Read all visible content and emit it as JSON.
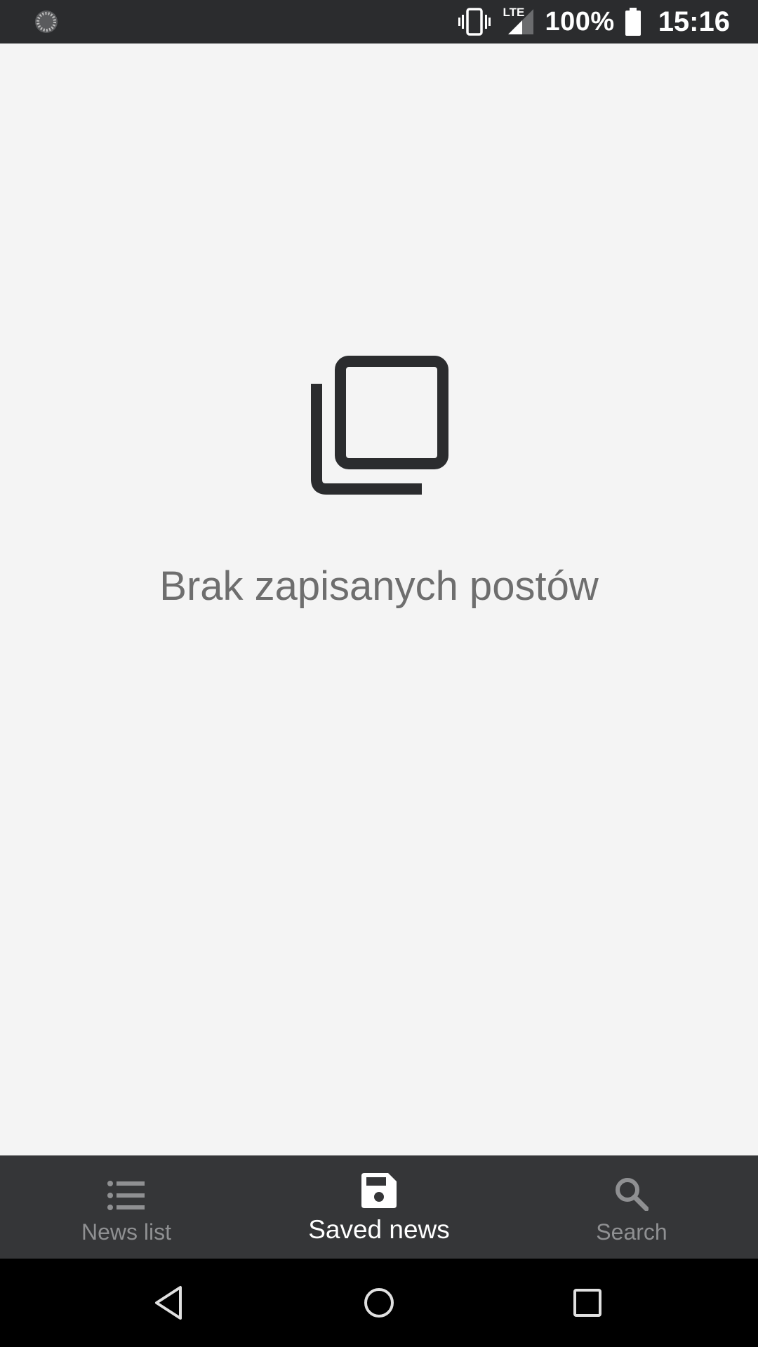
{
  "status_bar": {
    "spinner_icon": "sync-spinner-icon",
    "vibrate_icon": "vibrate-icon",
    "network_label": "LTE",
    "signal_icon": "signal-icon",
    "battery_percent": "100%",
    "battery_icon": "battery-icon",
    "time": "15:16"
  },
  "main": {
    "empty_icon": "copy-icon",
    "empty_message": "Brak zapisanych postów"
  },
  "bottom_nav": {
    "items": [
      {
        "label": "News list",
        "icon": "list-icon",
        "active": false
      },
      {
        "label": "Saved news",
        "icon": "save-icon",
        "active": true
      },
      {
        "label": "Search",
        "icon": "search-icon",
        "active": false
      }
    ]
  },
  "system_nav": {
    "back": "back-icon",
    "home": "home-icon",
    "recents": "recents-icon"
  },
  "colors": {
    "background": "#f4f4f4",
    "status_bar": "#2b2c2e",
    "bottom_nav": "#353638",
    "inactive": "#8f9092",
    "active": "#ffffff",
    "empty_text": "#6e6e6e"
  }
}
